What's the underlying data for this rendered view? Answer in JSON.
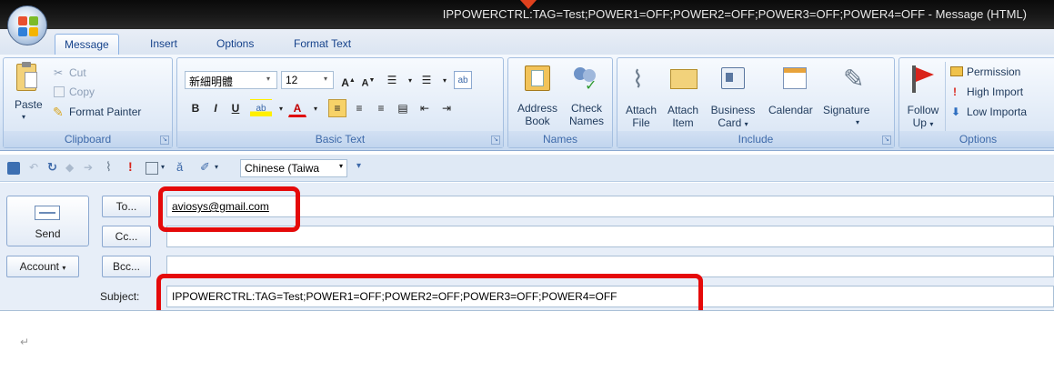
{
  "window": {
    "title": "IPPOWERCTRL:TAG=Test;POWER1=OFF;POWER2=OFF;POWER3=OFF;POWER4=OFF - Message (HTML)"
  },
  "tabs": [
    "Message",
    "Insert",
    "Options",
    "Format Text"
  ],
  "clipboard": {
    "paste": "Paste",
    "cut": "Cut",
    "copy": "Copy",
    "format_painter": "Format Painter",
    "label": "Clipboard"
  },
  "basic_text": {
    "font": "新細明體",
    "size": "12",
    "label": "Basic Text"
  },
  "names": {
    "address_book_1": "Address",
    "address_book_2": "Book",
    "check_names_1": "Check",
    "check_names_2": "Names",
    "label": "Names"
  },
  "include": {
    "attach_file_1": "Attach",
    "attach_file_2": "File",
    "attach_item_1": "Attach",
    "attach_item_2": "Item",
    "business_card_1": "Business",
    "business_card_2": "Card",
    "calendar": "Calendar",
    "signature": "Signature",
    "label": "Include"
  },
  "options": {
    "follow_up_1": "Follow",
    "follow_up_2": "Up",
    "permission": "Permission",
    "high_importance": "High Import",
    "low_importance": "Low Importa",
    "label": "Options"
  },
  "qat": {
    "language": "Chinese (Taiwa"
  },
  "header": {
    "send": "Send",
    "to": "To...",
    "cc": "Cc...",
    "account": "Account",
    "bcc": "Bcc...",
    "subject_label": "Subject:",
    "to_value": "aviosys@gmail.com",
    "cc_value": "",
    "bcc_value": "",
    "subject_value": "IPPOWERCTRL:TAG=Test;POWER1=OFF;POWER2=OFF;POWER3=OFF;POWER4=OFF"
  },
  "body": {
    "para_mark": "↵"
  },
  "colors": {
    "highlight": "#e50a0a",
    "ribbon": "#dde8f6",
    "titlebar": "#111111"
  }
}
